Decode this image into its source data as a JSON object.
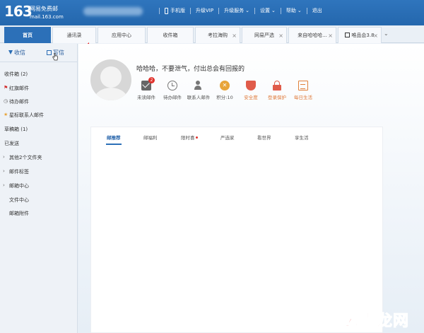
{
  "logo": {
    "number": "163",
    "title": "网易免费邮",
    "domain": "mail.163.com"
  },
  "topnav": {
    "items": [
      "手机版",
      "升级VIP",
      "升级服务",
      "设置",
      "帮助",
      "退出"
    ]
  },
  "tabs": [
    {
      "label": "首页",
      "active": true
    },
    {
      "label": "通讯录"
    },
    {
      "label": "应用中心"
    },
    {
      "label": "收件箱"
    },
    {
      "label": "考拉海购"
    },
    {
      "label": "网易严选"
    },
    {
      "label": "来自哈哈哈..."
    },
    {
      "label": "唯品会3.8"
    }
  ],
  "sidebar": {
    "receive": "收信",
    "compose": "写信",
    "folders": [
      "收件箱 (2)",
      "红旗邮件",
      "待办邮件",
      "星标联系人邮件",
      "草稿箱 (1)",
      "已发送",
      "其他2个文件夹",
      "邮件标签",
      "邮箱中心",
      "文件中心",
      "邮箱附件"
    ]
  },
  "main": {
    "greeting": "哈哈哈，不要泄气，付出总会有回报的",
    "quick_items": [
      {
        "label": "未读邮件",
        "icon": "mail-icon",
        "badge": "2"
      },
      {
        "label": "待办邮件",
        "icon": "clock-icon"
      },
      {
        "label": "联系人邮件",
        "icon": "star-contact-icon"
      },
      {
        "label": "积分:10",
        "icon": "points-icon"
      },
      {
        "label": "安全度",
        "icon": "shield-icon"
      },
      {
        "label": "登录保护",
        "icon": "lock-icon"
      },
      {
        "label": "每日生活",
        "icon": "calendar-icon"
      }
    ],
    "content_tabs": [
      "邮推荐",
      "邮福利",
      "限时喜",
      "严选家",
      "看世界",
      "享生活"
    ]
  },
  "watermark": "云南龙网",
  "colors": {
    "brand_blue": "#2c70b8",
    "alert_red": "#e0322c",
    "orange_label": "#e07a3a"
  }
}
